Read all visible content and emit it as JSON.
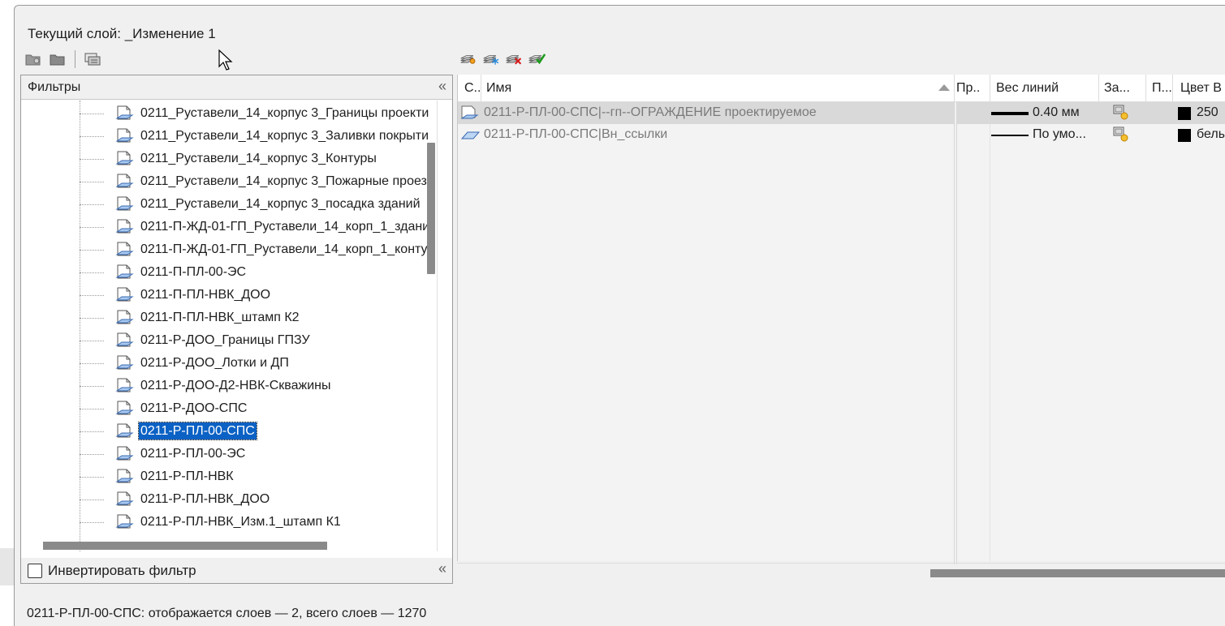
{
  "current_layer": {
    "label": "Текущий слой: _Изменение 1"
  },
  "toolbar_left": {
    "icons": [
      "new-property-filter-icon",
      "new-group-filter-icon",
      "layer-states-manager-icon"
    ]
  },
  "toolbar_right": {
    "icons": [
      "new-layer-icon",
      "new-layer-vp-frozen-icon",
      "delete-layer-icon",
      "set-current-icon"
    ]
  },
  "filters": {
    "title": "Фильтры",
    "collapse": "«",
    "items": [
      "0211_Руставели_14_корпус 3_Границы проекти",
      "0211_Руставели_14_корпус 3_Заливки покрыти",
      "0211_Руставели_14_корпус 3_Контуры",
      "0211_Руставели_14_корпус 3_Пожарные проез",
      "0211_Руставели_14_корпус 3_посадка зданий",
      "0211-П-ЖД-01-ГП_Руставели_14_корп_1_здани",
      "0211-П-ЖД-01-ГП_Руставели_14_корп_1_конту",
      "0211-П-ПЛ-00-ЭС",
      "0211-П-ПЛ-НВК_ДОО",
      "0211-П-ПЛ-НВК_штамп К2",
      "0211-Р-ДОО_Границы ГПЗУ",
      "0211-Р-ДОО_Лотки и ДП",
      "0211-Р-ДОО-Д2-НВК-Скважины",
      "0211-Р-ДОО-СПС",
      "0211-Р-ПЛ-00-СПС",
      "0211-Р-ПЛ-00-ЭС",
      "0211-Р-ПЛ-НВК",
      "0211-Р-ПЛ-НВК_ДОО",
      "0211-Р-ПЛ-НВК_Изм.1_штамп К1"
    ],
    "selected": "0211-Р-ПЛ-00-СПС",
    "invert_label": "Инвертировать фильтр",
    "invert_checked": false
  },
  "layers_table": {
    "columns": {
      "status": "С..",
      "name": "Имя",
      "p": "Пр..",
      "lineweight": "Вес линий",
      "freeze_new_vp": "За...",
      "plot": "П...",
      "vp_color": "Цвет В"
    },
    "rows": [
      {
        "name": "0211-Р-ПЛ-00-СПС|--гп--ОГРАЖДЕНИЕ проектируемое",
        "lineweight": "0.40 мм",
        "color_text": "250",
        "color_hex": "#000000",
        "selected": true
      },
      {
        "name": "0211-Р-ПЛ-00-СПС|Вн_ссылки",
        "lineweight": "По умо...",
        "color_text": "белы",
        "color_hex": "#000000",
        "selected": false
      }
    ]
  },
  "status_bar": {
    "text": "0211-Р-ПЛ-00-СПС: отображается слоев — 2, всего слоев — 1270"
  }
}
